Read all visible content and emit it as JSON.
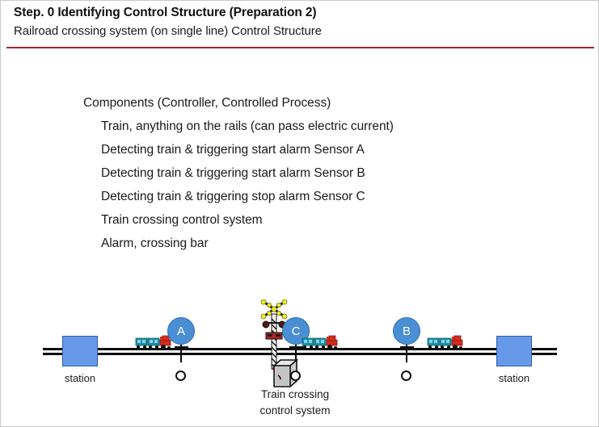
{
  "slide": {
    "title": "Step. 0 Identifying Control Structure  (Preparation  2)",
    "subtitle": "Railroad crossing system (on single line) Control Structure",
    "rule_color": "#9e2a2b"
  },
  "content": {
    "heading": "Components (Controller, Controlled Process)",
    "items": [
      "Train, anything on the rails (can pass electric current)",
      "Detecting train & triggering start alarm Sensor A",
      "Detecting train & triggering start alarm Sensor B",
      "Detecting train & triggering stop alarm Sensor C",
      "Train crossing control system",
      "Alarm, crossing bar"
    ]
  },
  "diagram": {
    "station_left_label": "station",
    "station_right_label": "station",
    "sensors": [
      {
        "letter": "A"
      },
      {
        "letter": "C"
      },
      {
        "letter": "B"
      }
    ],
    "cabinet_label": "Train crossing\ncontrol system",
    "cabinet_label_line1": "Train crossing",
    "cabinet_label_line2": "control system",
    "colors": {
      "station_fill": "#6699e8",
      "station_stroke": "#2e5fa3",
      "sensor_fill": "#4a8fd4",
      "sensor_stroke": "#2f6fab",
      "rail": "#0d0d0d",
      "train_car": "#1f8fa3",
      "train_engine": "#d52b1e",
      "signal_light_on": "#e8e82a",
      "signal_light_off": "#5e1b1b",
      "cabinet": "#cccccc"
    }
  }
}
